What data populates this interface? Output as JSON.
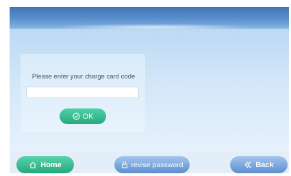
{
  "card": {
    "label": "Please enter your charge card code",
    "input_value": "",
    "ok_label": "OK"
  },
  "footer": {
    "home_label": "Home",
    "revise_password_label": "revise password",
    "back_label": "Back"
  },
  "icons": {
    "ok": "check-circle-icon",
    "home": "home-icon",
    "revise_password": "lock-icon",
    "back": "double-chevron-left-icon"
  },
  "colors": {
    "header": "#4a80c2",
    "green_button": "#2fb88b",
    "blue_button": "#6f9fd8",
    "content_background": "#cfe4f6"
  }
}
